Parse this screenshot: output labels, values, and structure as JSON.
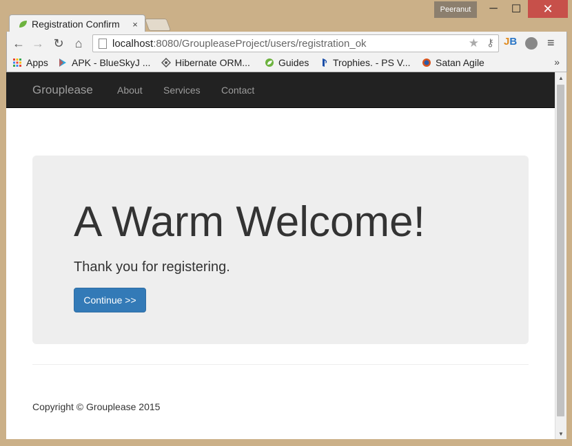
{
  "window": {
    "user": "Peeranut",
    "minimize_glyph": "─",
    "maximize_glyph": "☐",
    "close_glyph": "✕"
  },
  "tab": {
    "title": "Registration Confirm",
    "close_glyph": "×",
    "icon": "leaf-icon"
  },
  "toolbar": {
    "back_glyph": "←",
    "forward_glyph": "→",
    "reload_glyph": "↻",
    "home_glyph": "⌂",
    "url_host": "localhost",
    "url_path": ":8080/GroupleaseProject/users/registration_ok",
    "star_glyph": "★",
    "key_glyph": "⚷",
    "ext_jb_1": "J",
    "ext_jb_2": "B",
    "menu_glyph": "≡"
  },
  "bookmarks": {
    "items": [
      {
        "label": "Apps",
        "icon": "apps-grid-icon"
      },
      {
        "label": "APK - BlueSkyJ ...",
        "icon": "play-store-icon"
      },
      {
        "label": "Hibernate ORM...",
        "icon": "hibernate-icon"
      },
      {
        "label": "Guides",
        "icon": "spring-leaf-icon"
      },
      {
        "label": "Trophies. - PS V...",
        "icon": "playstation-icon"
      },
      {
        "label": "Satan Agile",
        "icon": "satan-agile-icon"
      }
    ],
    "more": "»"
  },
  "navbar": {
    "brand": "Grouplease",
    "links": [
      "About",
      "Services",
      "Contact"
    ]
  },
  "jumbotron": {
    "title": "A Warm Welcome!",
    "subtitle": "Thank you for registering.",
    "button": "Continue >>"
  },
  "footer": {
    "text": "Copyright © Grouplease 2015"
  },
  "scrollbar": {
    "up_glyph": "▲",
    "down_glyph": "▼"
  },
  "colors": {
    "navbar_bg": "#222222",
    "navbar_text": "#9d9d9d",
    "jumbotron_bg": "#eeeeee",
    "primary_button": "#337ab7",
    "close_button": "#c7504a"
  }
}
